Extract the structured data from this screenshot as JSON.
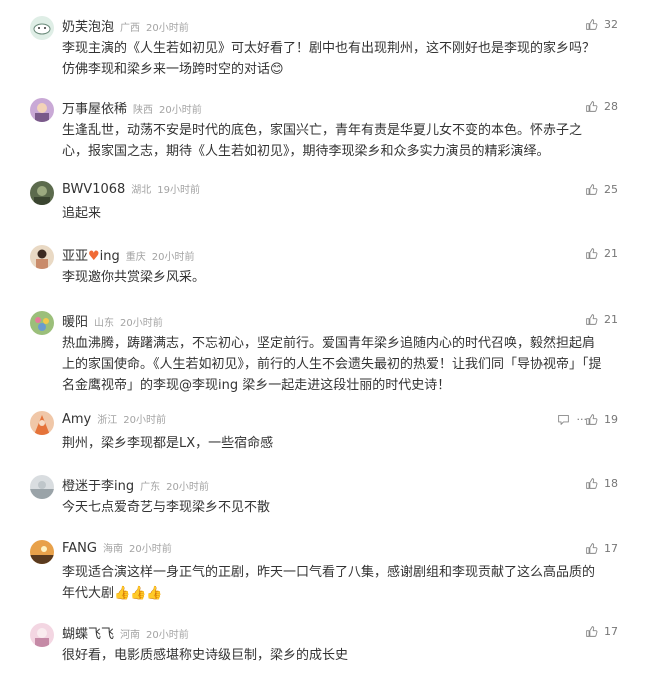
{
  "comments": [
    {
      "user": "奶芙泡泡",
      "location": "广西",
      "time": "20小时前",
      "likes": "32",
      "text": "李现主演的《人生若如初见》可太好看了！剧中也有出现荆州，这不刚好也是李现的家乡吗？仿佛李现和梁乡来一场跨时空的对话😊"
    },
    {
      "user": "万事屋依稀",
      "location": "陕西",
      "time": "20小时前",
      "likes": "28",
      "text": "生逢乱世，动荡不安是时代的底色，家国兴亡，青年有责是华夏儿女不变的本色。怀赤子之心，报家国之志，期待《人生若如初见》，期待李现梁乡和众多实力演员的精彩演绎。"
    },
    {
      "user": "BWV1068",
      "location": "湖北",
      "time": "19小时前",
      "likes": "25",
      "text": "追起来"
    },
    {
      "user": "亚亚",
      "user_suffix": "ing",
      "location": "重庆",
      "time": "20小时前",
      "likes": "21",
      "text": "李现邀你共赏梁乡风采。"
    },
    {
      "user": "暖阳",
      "location": "山东",
      "time": "20小时前",
      "likes": "21",
      "text": "热血沸腾，踌躇满志，不忘初心，坚定前行。爱国青年梁乡追随内心的时代召唤，毅然担起肩上的家国使命。《人生若如初见》，前行的人生不会遗失最初的热爱！让我们同「导协视帝」「提名金鹰视帝」的李现@李现ing 梁乡一起走进这段壮丽的时代史诗！"
    },
    {
      "user": "Amy",
      "location": "浙江",
      "time": "20小时前",
      "likes": "19",
      "text": "荆州，梁乡李现都是LX，一些宿命感",
      "more": "···"
    },
    {
      "user": "橙迷于李ing",
      "location": "广东",
      "time": "20小时前",
      "likes": "18",
      "text": "今天七点爱奇艺与李现梁乡不见不散"
    },
    {
      "user": "FANG",
      "location": "海南",
      "time": "20小时前",
      "likes": "17",
      "text": "李现适合演这样一身正气的正剧，昨天一口气看了八集，感谢剧组和李现贡献了这么高品质的年代大剧👍👍👍"
    },
    {
      "user": "蝴蝶飞飞",
      "location": "河南",
      "time": "20小时前",
      "likes": "17",
      "text": "很好看，电影质感堪称史诗级巨制，梁乡的成长史"
    }
  ]
}
